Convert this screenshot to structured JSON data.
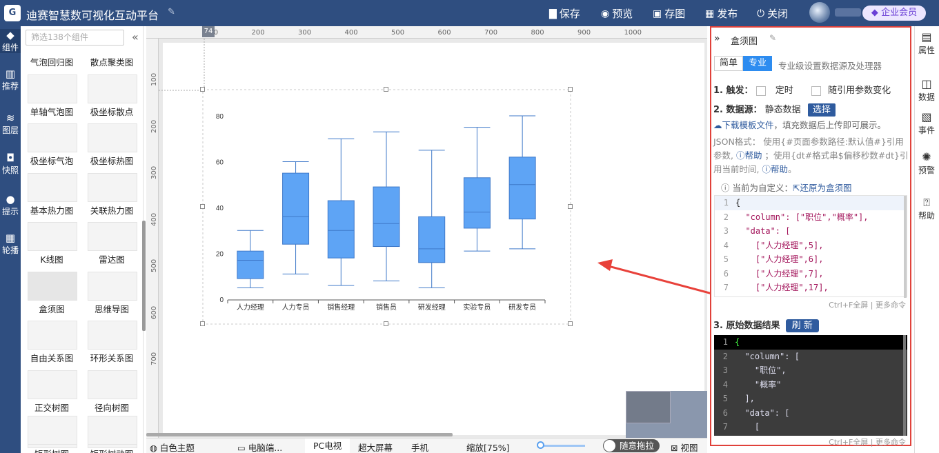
{
  "app": {
    "title": "迪赛智慧数可视化互动平台",
    "logo": "G"
  },
  "toolbar": [
    {
      "icon": "save-icon",
      "glyph": "▇",
      "label": "保存"
    },
    {
      "icon": "preview-icon",
      "glyph": "◉",
      "label": "预览"
    },
    {
      "icon": "image-icon",
      "glyph": "▣",
      "label": "存图"
    },
    {
      "icon": "publish-icon",
      "glyph": "▦",
      "label": "发布"
    },
    {
      "icon": "power-icon",
      "glyph": "⏻",
      "label": "关闭"
    }
  ],
  "user": {
    "badge": "企业会员"
  },
  "leftnav": [
    {
      "icon": "component-icon",
      "glyph": "◆",
      "label": "组件"
    },
    {
      "icon": "ai-icon",
      "glyph": "▥",
      "label": "推荐"
    },
    {
      "icon": "layers-icon",
      "glyph": "≋",
      "label": "图层"
    },
    {
      "icon": "camera-icon",
      "glyph": "◘",
      "label": "快照"
    },
    {
      "icon": "bulb-icon",
      "glyph": "●",
      "label": "提示"
    },
    {
      "icon": "windows-icon",
      "glyph": "▦",
      "label": "轮播"
    }
  ],
  "components": {
    "search_placeholder": "筛选138个组件",
    "items": [
      "气泡回归图",
      "散点聚类图",
      "单轴气泡图",
      "极坐标散点",
      "极坐标气泡",
      "极坐标热图",
      "基本热力图",
      "关联热力图",
      "K线图",
      "雷达图",
      "盒须图",
      "思维导图",
      "自由关系图",
      "环形关系图",
      "正交树图",
      "径向树图",
      "矩形树图",
      "矩形树动图"
    ]
  },
  "ruler": {
    "h": [
      "100",
      "200",
      "300",
      "400",
      "500",
      "600",
      "700",
      "800",
      "900",
      "1000"
    ],
    "v": [
      "100",
      "200",
      "300",
      "400",
      "500",
      "600",
      "700"
    ],
    "marker": "74"
  },
  "bottombar": {
    "theme": "白色主题",
    "tabs": [
      "电脑端...",
      "PC电视",
      "超大屏幕",
      "手机"
    ],
    "zoom": "缩放[75%]",
    "drag": "随意拖拉",
    "view": "视图"
  },
  "panel": {
    "title": "盒须图",
    "mode_simple": "简单",
    "mode_pro": "专业",
    "mode_desc": "专业级设置数据源及处理器",
    "trigger_label": "1. 触发：",
    "trigger_timer": "定时",
    "trigger_param": "随引用参数变化",
    "source_label": "2. 数据源：",
    "source_value": "静态数据",
    "source_btn": "选择",
    "download": "下载模板文件",
    "download_tail": "，填充数据后上传即可展示。",
    "json_hint1": "JSON格式： 使用{#页面参数路径:默认值#}引用",
    "json_hint2": "参数,",
    "help": "帮助",
    "json_hint3": "；使用{dt#格式串$偏移秒数#dt}引",
    "json_hint4": "用当前时间,",
    "help2": "帮助",
    "dot": "。",
    "custom_note": "当前为自定义：",
    "restore": "还原为盒须图",
    "code": [
      "{",
      "  \"column\": [\"职位\",\"概率\"],",
      "  \"data\": [",
      "    [\"人力经理\",5],",
      "    [\"人力经理\",6],",
      "    [\"人力经理\",7],",
      "    [\"人力经理\",17],"
    ],
    "code_hint": "Ctrl+F全屏 | 更多命令",
    "raw_label": "3. 原始数据结果",
    "refresh": "刷 新",
    "raw_code": [
      "{",
      "  \"column\": [",
      "    \"职位\",",
      "    \"概率\"",
      "  ],",
      "  \"data\": [",
      "    ["
    ],
    "raw_hint": "Ctrl+F全屏 | 更多命令"
  },
  "rightnav": [
    {
      "icon": "attribute-icon",
      "glyph": "▤",
      "label": "属性"
    },
    {
      "icon": "database-icon",
      "glyph": "◫",
      "label": "数据"
    },
    {
      "icon": "event-icon",
      "glyph": "▧",
      "label": "事件"
    },
    {
      "icon": "alarm-icon",
      "glyph": "✺",
      "label": "预警"
    },
    {
      "icon": "help-icon",
      "glyph": "⍰",
      "label": "帮助"
    }
  ],
  "colors": {
    "topbar": "#2f4e80",
    "box_fill": "#5ea4f5",
    "box_stroke": "#3f79c9",
    "highlight": "#e0413a",
    "accent": "#2d8cf0"
  },
  "chart_data": {
    "type": "boxplot",
    "categories": [
      "人力经理",
      "人力专员",
      "销售经理",
      "销售员",
      "研发经理",
      "实验专员",
      "研发专员"
    ],
    "boxes": [
      {
        "min": 5,
        "q1": 9,
        "median": 17,
        "q3": 21,
        "max": 30
      },
      {
        "min": 11,
        "q1": 24,
        "median": 36,
        "q3": 55,
        "max": 60
      },
      {
        "min": 6,
        "q1": 18,
        "median": 30,
        "q3": 43,
        "max": 70
      },
      {
        "min": 8,
        "q1": 23,
        "median": 33,
        "q3": 49,
        "max": 73
      },
      {
        "min": 5,
        "q1": 16,
        "median": 22,
        "q3": 36,
        "max": 65
      },
      {
        "min": 21,
        "q1": 31,
        "median": 38,
        "q3": 53,
        "max": 75
      },
      {
        "min": 22,
        "q1": 35,
        "median": 50,
        "q3": 62,
        "max": 80
      }
    ],
    "yticks": [
      0,
      20,
      40,
      60,
      80
    ],
    "ylim": [
      0,
      80
    ],
    "grid": false
  }
}
